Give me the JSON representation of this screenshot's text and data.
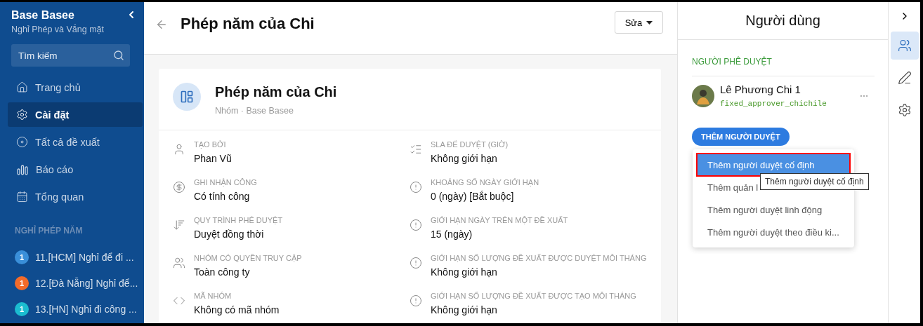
{
  "sidebar": {
    "title": "Base Basee",
    "subtitle": "Nghỉ Phép và Vắng mặt",
    "search": {
      "placeholder": "Tìm kiếm"
    },
    "items": [
      {
        "label": "Trang chủ",
        "kind": "home",
        "selected": false
      },
      {
        "label": "Cài đặt",
        "kind": "settings",
        "selected": true
      },
      {
        "label": "Tất cả đề xuất",
        "kind": "all",
        "selected": false
      },
      {
        "label": "Báo cáo",
        "kind": "report",
        "selected": false
      },
      {
        "label": "Tổng quan",
        "kind": "overview",
        "selected": false
      }
    ],
    "section": "NGHỈ PHÉP NĂM",
    "groups": [
      {
        "count": "1",
        "label": "11.[HCM] Nghỉ để đi ...",
        "color": "#3a8fd9"
      },
      {
        "count": "1",
        "label": "12.[Đà Nẵng] Nghỉ để...",
        "color": "#f26b2a"
      },
      {
        "count": "1",
        "label": "13.[HN] Nghỉ đi công ...",
        "color": "#1bbcd0"
      }
    ]
  },
  "header": {
    "title": "Phép năm của Chi",
    "button": "Sửa"
  },
  "card": {
    "title": "Phép năm của Chi",
    "subtitle": "Nhóm · Base Basee",
    "fields": [
      {
        "kind": "creator",
        "label": "TẠO BỞI",
        "value": "Phan Vũ"
      },
      {
        "kind": "sla",
        "label": "SLA ĐỂ DUYỆT (GIỜ)",
        "value": "Không giới hạn"
      },
      {
        "kind": "billing",
        "label": "GHI NHẬN CÔNG",
        "value": "Có tính công"
      },
      {
        "kind": "limit",
        "label": "KHOẢNG SỐ NGÀY GIỚI HẠN",
        "value": "0 (ngày) [Bắt buộc]"
      },
      {
        "kind": "process",
        "label": "QUY TRÌNH PHÊ DUYỆT",
        "value": "Duyệt đồng thời"
      },
      {
        "kind": "limit",
        "label": "GIỚI HẠN NGÀY TRÊN MỘT ĐỀ XUẤT",
        "value": "15 (ngày)"
      },
      {
        "kind": "access",
        "label": "NHÓM CÓ QUYỀN TRUY CẬP",
        "value": "Toàn công ty"
      },
      {
        "kind": "limit",
        "label": "GIỚI HẠN SỐ LƯỢNG ĐỀ XUẤT ĐƯỢC DUYỆT MỖI THÁNG",
        "value": "Không giới hạn"
      },
      {
        "kind": "code",
        "label": "MÃ NHÓM",
        "value": "Không có mã nhóm"
      },
      {
        "kind": "limit",
        "label": "GIỚI HẠN SỐ LƯỢNG ĐỀ XUẤT ĐƯỢC TẠO MỖI THÁNG",
        "value": "Không giới hạn"
      }
    ]
  },
  "panel": {
    "title": "Người dùng",
    "section": "NGƯỜI PHÊ DUYỆT",
    "approver": {
      "name": "Lê Phương Chi 1",
      "code": "fixed_approver_chichile"
    },
    "add_button": "THÊM NGƯỜI DUYỆT",
    "menu": [
      {
        "label": "Thêm người duyệt cố định",
        "selected": true,
        "outlined": true
      },
      {
        "label": "Thêm quản l",
        "selected": false,
        "outlined": false
      },
      {
        "label": "Thêm người duyệt linh động",
        "selected": false,
        "outlined": false
      },
      {
        "label": "Thêm người duyệt theo điều ki...",
        "selected": false,
        "outlined": false
      }
    ],
    "tooltip": "Thêm người duyệt cố định"
  },
  "rail": [
    {
      "kind": "users",
      "selected": true
    },
    {
      "kind": "edit",
      "selected": false
    },
    {
      "kind": "settings",
      "selected": false
    }
  ]
}
